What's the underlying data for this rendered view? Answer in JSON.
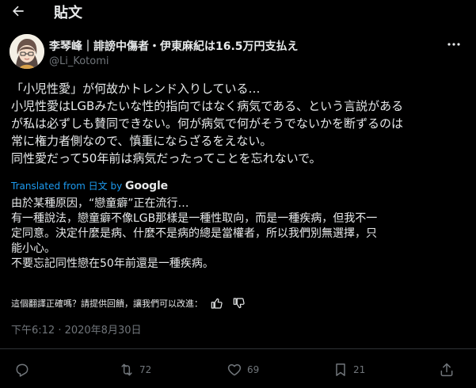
{
  "header": {
    "title": "貼文",
    "back_icon": "arrow-left-icon"
  },
  "author": {
    "display_name": "李琴峰｜誹謗中傷者・伊東麻紀は16.5万円支払え",
    "handle": "@Li_Kotomi"
  },
  "tweet": {
    "original_lines": [
      "「小児性愛」が何故かトレンド入りしている…",
      "小児性愛はLGBみたいな性的指向ではなく病気である、という言説がある",
      "が私は必ずしも賛同できない。何が病気で何がそうでないかを断ずるのは",
      "常に権力者側なので、慎重にならざるをえない。",
      "同性愛だって50年前は病気だったってことを忘れないで。"
    ],
    "translated_prefix": "Translated from 日文 by",
    "translated_brand": "Google",
    "translated_lines": [
      "由於某種原因，“戀童癖”正在流行…",
      "有一種說法，戀童癖不像LGB那樣是一種性取向，而是一種疾病，但我不一",
      "定同意。決定什麼是病、什麼不是病的總是當權者，所以我們別無選擇，只",
      "能小心。",
      "不要忘記同性戀在50年前還是一種疾病。"
    ],
    "feedback_prompt": "這個翻譯正確嗎？請提供回饋，讓我們可以改進：",
    "timestamp": "下午6:12 · 2020年8月30日"
  },
  "actions": {
    "reply_count": "",
    "retweet_count": "72",
    "like_count": "69",
    "bookmark_count": "21"
  },
  "colors": {
    "background": "#000000",
    "text": "#e7e9ea",
    "muted": "#71767b",
    "link": "#1d9bf0",
    "divider": "#2f3336"
  }
}
